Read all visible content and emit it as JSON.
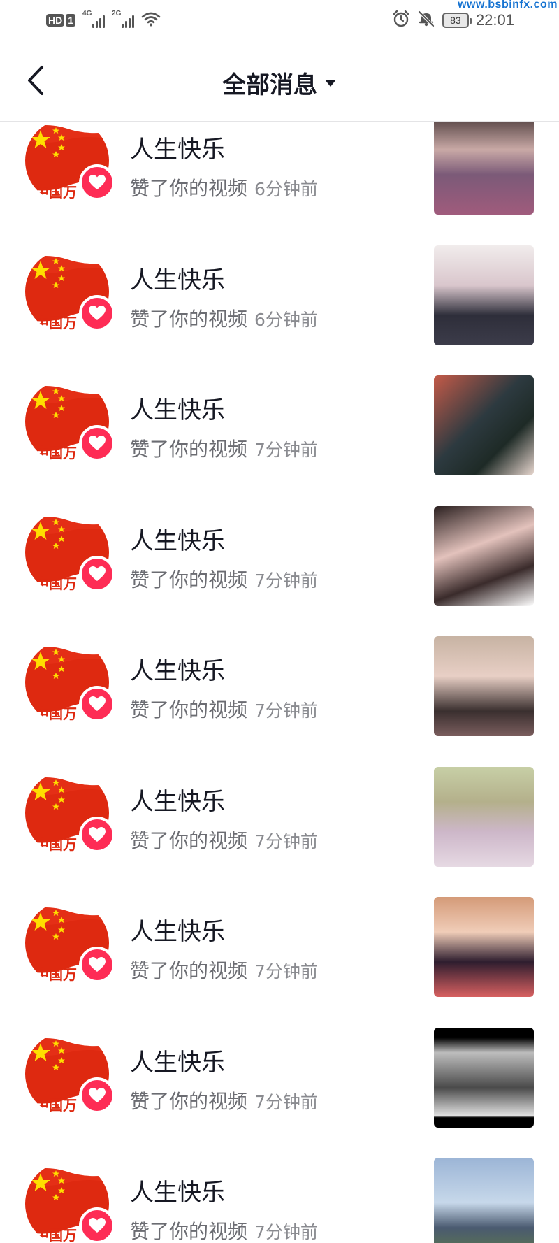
{
  "status_bar": {
    "hd_label": "HD",
    "sim_label": "1",
    "net1_label": "4G",
    "net2_label": "2G",
    "battery": "83",
    "time": "22:01",
    "watermark": "www.bsbinfx.com",
    "icons": [
      "alarm-icon",
      "bell-muted-icon",
      "wifi-icon",
      "signal-icon"
    ]
  },
  "header": {
    "title": "全部消息",
    "back_icon": "chevron-left-icon",
    "dropdown_icon": "caret-down-icon"
  },
  "colors": {
    "like_badge": "#fe2c55",
    "flag_red": "#de2910",
    "flag_star": "#ffde00",
    "name_text": "#161823",
    "action_text": "#6b6c72",
    "time_text": "#8a8b90"
  },
  "notifications": [
    {
      "name": "人生快乐",
      "action": "赞了你的视频",
      "time": "6分钟前",
      "avatar_caption": "中国万"
    },
    {
      "name": "人生快乐",
      "action": "赞了你的视频",
      "time": "6分钟前",
      "avatar_caption": "中国万"
    },
    {
      "name": "人生快乐",
      "action": "赞了你的视频",
      "time": "7分钟前",
      "avatar_caption": "中国万"
    },
    {
      "name": "人生快乐",
      "action": "赞了你的视频",
      "time": "7分钟前",
      "avatar_caption": "中国万"
    },
    {
      "name": "人生快乐",
      "action": "赞了你的视频",
      "time": "7分钟前",
      "avatar_caption": "中国万"
    },
    {
      "name": "人生快乐",
      "action": "赞了你的视频",
      "time": "7分钟前",
      "avatar_caption": "中国万"
    },
    {
      "name": "人生快乐",
      "action": "赞了你的视频",
      "time": "7分钟前",
      "avatar_caption": "中国万"
    },
    {
      "name": "人生快乐",
      "action": "赞了你的视频",
      "time": "7分钟前",
      "avatar_caption": "中国万"
    },
    {
      "name": "人生快乐",
      "action": "赞了你的视频",
      "time": "7分钟前",
      "avatar_caption": "中国万"
    }
  ]
}
